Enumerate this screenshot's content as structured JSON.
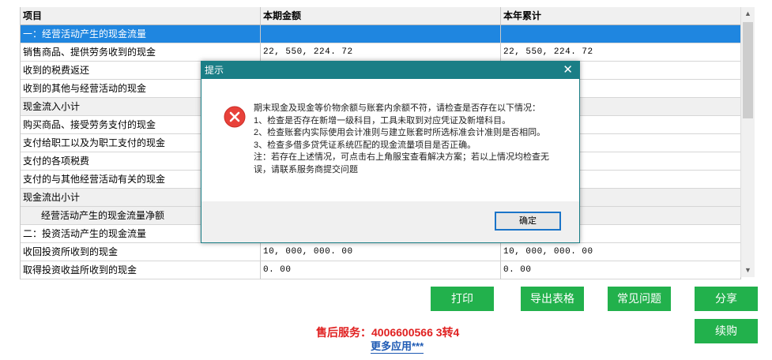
{
  "table": {
    "headers": [
      "项目",
      "本期金额",
      "本年累计"
    ],
    "rows": [
      {
        "name": "一：经营活动产生的现金流量",
        "current": "",
        "ytd": ""
      },
      {
        "name": "销售商品、提供劳务收到的现金",
        "current": "22, 550, 224. 72",
        "ytd": "22, 550, 224. 72"
      },
      {
        "name": "收到的税费返还",
        "current": "",
        "ytd": ""
      },
      {
        "name": "收到的其他与经营活动的现金",
        "current": "",
        "ytd": ""
      },
      {
        "name": "现金流入小计",
        "current": "",
        "ytd": ""
      },
      {
        "name": "购买商品、接受劳务支付的现金",
        "current": "",
        "ytd": ""
      },
      {
        "name": "支付给职工以及为职工支付的现金",
        "current": "",
        "ytd": ""
      },
      {
        "name": "支付的各项税费",
        "current": "",
        "ytd": ""
      },
      {
        "name": "支付的与其他经营活动有关的现金",
        "current": "",
        "ytd": ""
      },
      {
        "name": "现金流出小计",
        "current": "",
        "ytd": ""
      },
      {
        "name": "经营活动产生的现金流量净额",
        "current": "",
        "ytd": ""
      },
      {
        "name": "二：投资活动产生的现金流量",
        "current": "",
        "ytd": ""
      },
      {
        "name": "收回投资所收到的现金",
        "current": "10, 000, 000. 00",
        "ytd": "10, 000, 000. 00"
      },
      {
        "name": "取得投资收益所收到的现金",
        "current": "0. 00",
        "ytd": "0. 00"
      }
    ]
  },
  "buttons": {
    "print": "打印",
    "export": "导出表格",
    "faq": "常见问题",
    "share": "分享",
    "renew": "续购"
  },
  "service_text": "售后服务：4006600566 3转4",
  "more_apps": "更多应用***",
  "dialog": {
    "title": "提示",
    "close": "✕",
    "lines": [
      "期末现金及现金等价物余额与账套内余额不符，请检查是否存在以下情况：",
      "1、检查是否存在新增一级科目，工具未取到对应凭证及新增科目。",
      "2、检查账套内实际使用会计准则与建立账套时所选标准会计准则是否相同。",
      "3、检查多借多贷凭证系统匹配的现金流量项目是否正确。",
      "注：若存在上述情况，可点击右上角服宝查看解决方案；若以上情况均检查无误，请联系服务商提交问题"
    ],
    "ok": "确定"
  },
  "colors": {
    "selected_row": "#1f86e0",
    "dialog_title_bar": "#1a7e86",
    "action_button": "#22b14c",
    "service_text": "#e02020",
    "link": "#1e5ab4"
  }
}
